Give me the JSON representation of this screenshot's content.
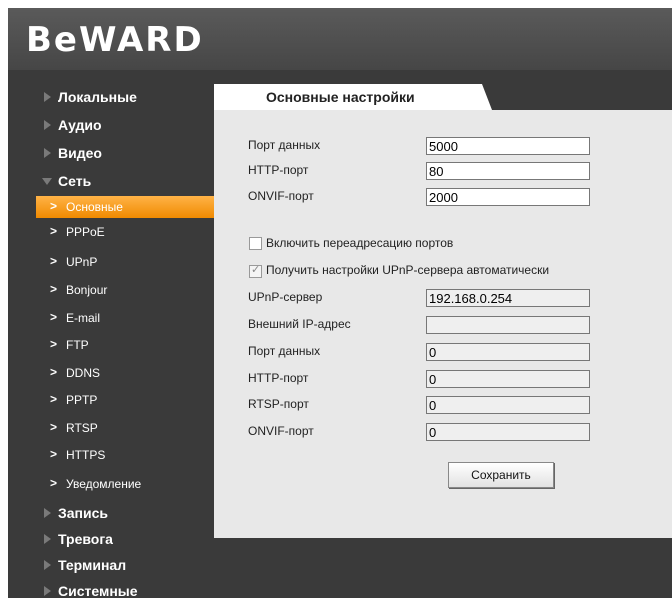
{
  "header": {
    "logo": "BeWARD"
  },
  "menu": [
    {
      "label": "Локальные"
    },
    {
      "label": "Аудио"
    },
    {
      "label": "Видео"
    },
    {
      "label": "Сеть"
    },
    {
      "label": "Запись"
    },
    {
      "label": "Тревога"
    },
    {
      "label": "Терминал"
    },
    {
      "label": "Системные"
    }
  ],
  "submenu": [
    {
      "label": "Основные",
      "active": true
    },
    {
      "label": "PPPoE"
    },
    {
      "label": "UPnP"
    },
    {
      "label": "Bonjour"
    },
    {
      "label": "E-mail"
    },
    {
      "label": "FTP"
    },
    {
      "label": "DDNS"
    },
    {
      "label": "PPTP"
    },
    {
      "label": "RTSP"
    },
    {
      "label": "HTTPS"
    },
    {
      "label": "Уведомление"
    }
  ],
  "tab": {
    "label": "Основные настройки"
  },
  "basic": {
    "data_port_label": "Порт данных",
    "data_port": "5000",
    "http_port_label": "HTTP-порт",
    "http_port": "80",
    "onvif_port_label": "ONVIF-порт",
    "onvif_port": "2000"
  },
  "forwarding": {
    "enable_label": "Включить переадресацию портов",
    "enable_checked": false,
    "auto_label": "Получить настройки UPnP-сервера автоматически",
    "auto_checked": true,
    "server_label": "UPnP-сервер",
    "server": "192.168.0.254",
    "ext_ip_label": "Внешний IP-адрес",
    "ext_ip": "",
    "data_port_label": "Порт данных",
    "data_port": "0",
    "http_port_label": "HTTP-порт",
    "http_port": "0",
    "rtsp_port_label": "RTSP-порт",
    "rtsp_port": "0",
    "onvif_port_label": "ONVIF-порт",
    "onvif_port": "0"
  },
  "actions": {
    "save_label": "Сохранить"
  },
  "colors": {
    "accent": "#f39200",
    "panel": "#e8e8e8",
    "sidebar": "#3a3a3a"
  }
}
